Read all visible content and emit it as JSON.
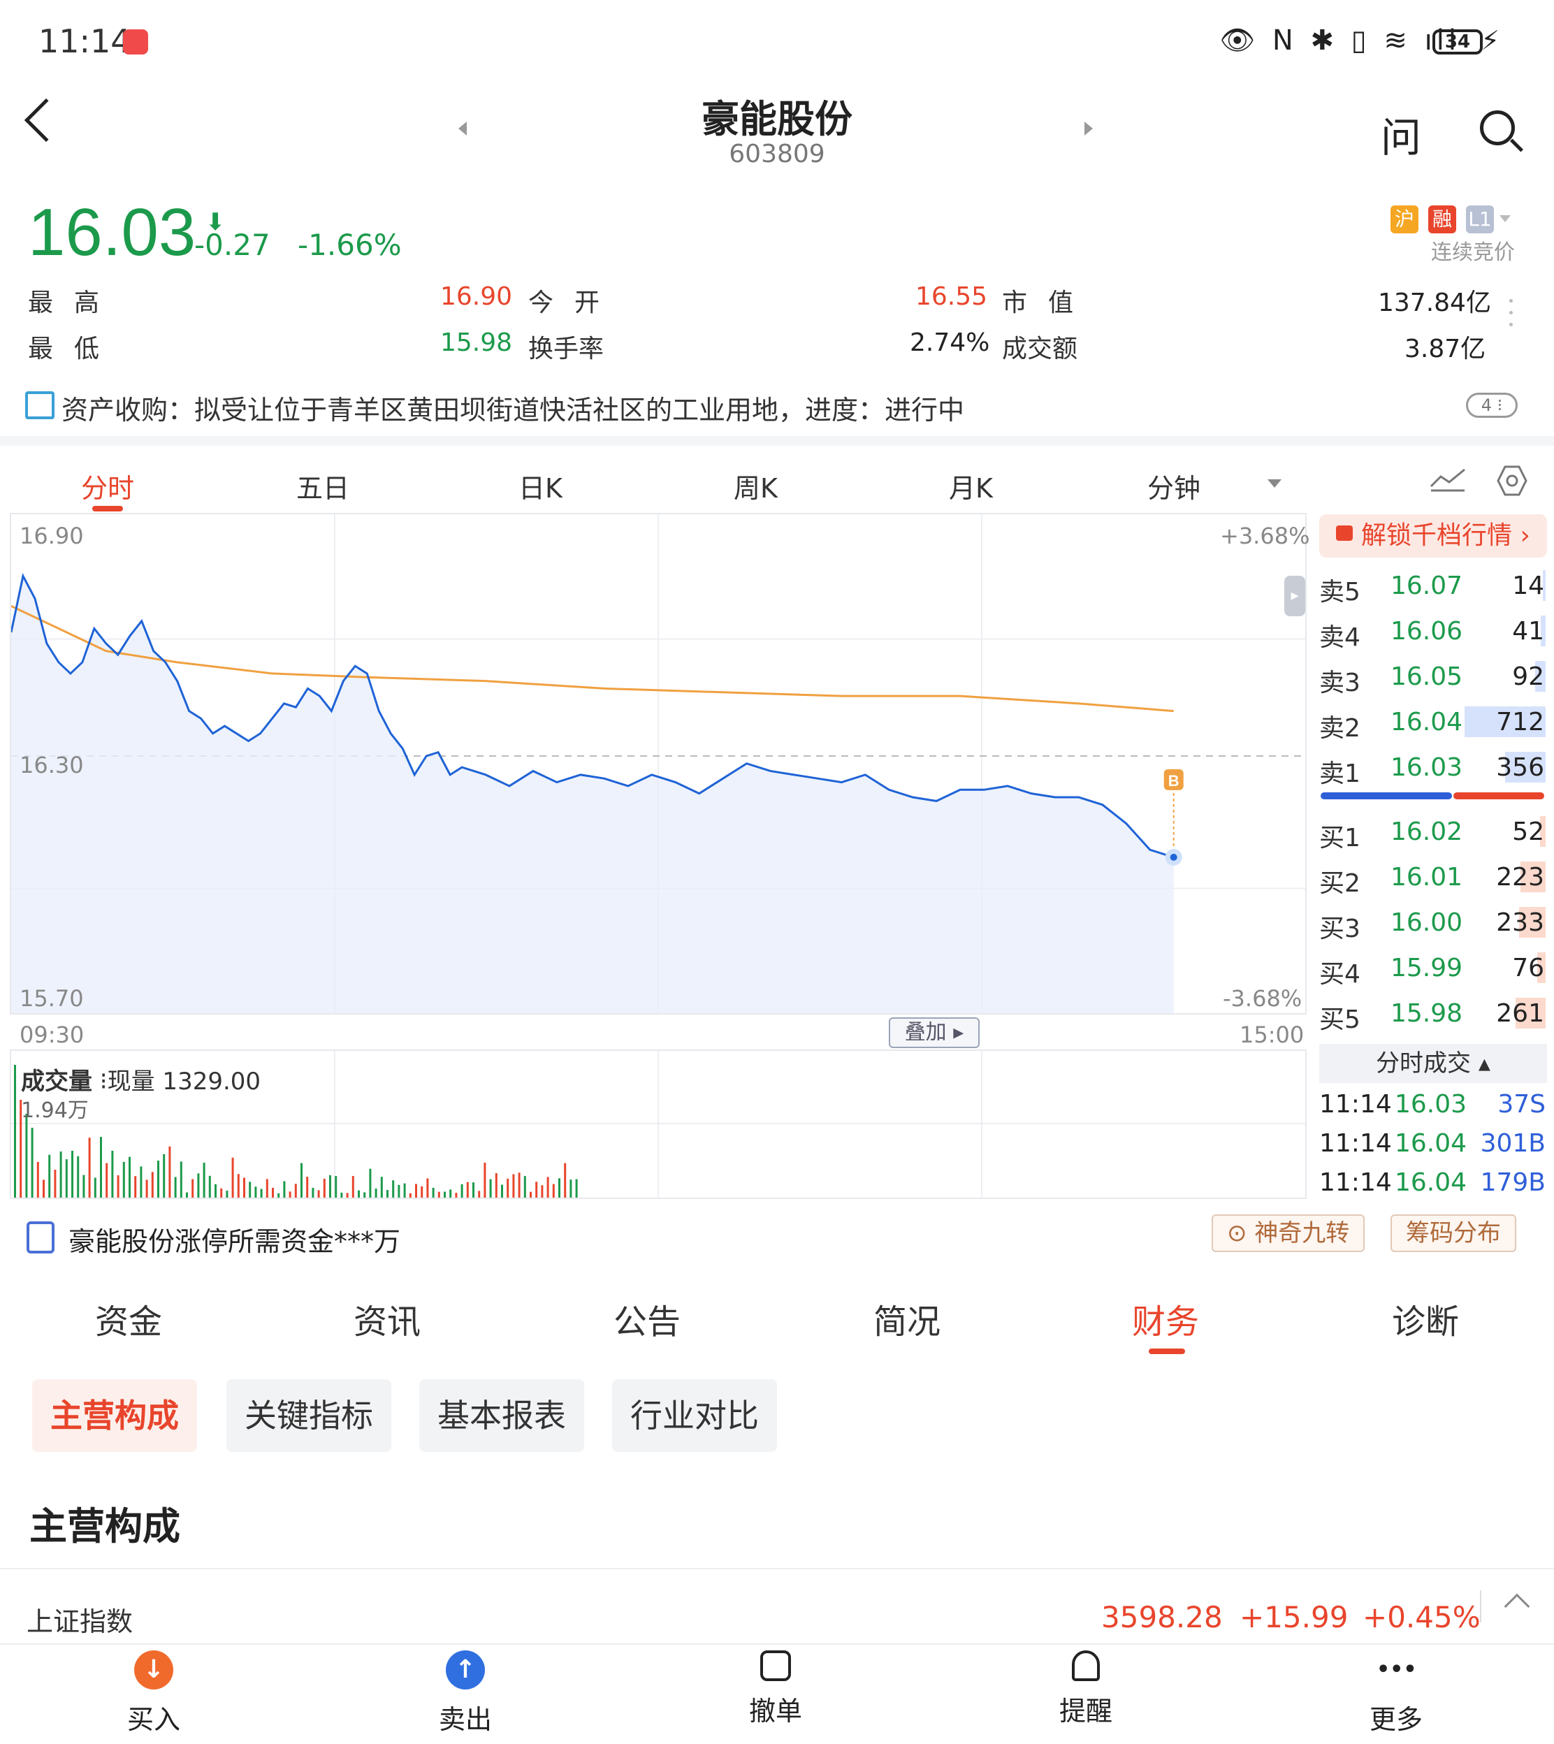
{
  "status": {
    "time": "11:14",
    "battery": "34"
  },
  "header": {
    "title": "豪能股份",
    "code": "603809"
  },
  "quote": {
    "price": "16.03",
    "change": "-0.27",
    "change_pct": "-1.66%",
    "tags": [
      "沪",
      "融",
      "L1"
    ],
    "auction": "连续竞价",
    "stats": [
      {
        "label": "最高",
        "value": "16.90"
      },
      {
        "label": "今开",
        "value": "16.55"
      },
      {
        "label": "市值",
        "value": "137.84亿"
      },
      {
        "label": "最低",
        "value": "15.98"
      },
      {
        "label": "换手率",
        "value": "2.74%"
      },
      {
        "label": "成交额",
        "value": "3.87亿"
      }
    ]
  },
  "notice": {
    "text": "资产收购：拟受让位于青羊区黄田坝街道快活社区的工业用地，进度：进行中",
    "badge": "4"
  },
  "chart_tabs": [
    "分时",
    "五日",
    "日K",
    "周K",
    "月K",
    "分钟"
  ],
  "chart": {
    "y_top": "16.90",
    "y_mid": "16.30",
    "y_bot": "15.70",
    "pct_top": "+3.68%",
    "pct_bot": "-3.68%",
    "t_start": "09:30",
    "t_end": "15:00",
    "overlay": "叠加",
    "marker": "B",
    "colors": {
      "price": "#1f63d6",
      "avg": "#f0a040",
      "fill": "#e8effb"
    }
  },
  "chart_data": {
    "type": "line",
    "ylim": [
      15.7,
      16.9
    ],
    "prev_close": 16.3,
    "x_total_minutes": 240,
    "x_start_label": "09:30",
    "x_end_label": "15:00",
    "series": [
      {
        "points": [
          [
            0,
            16.63
          ],
          [
            1,
            16.78
          ],
          [
            2,
            16.72
          ],
          [
            3,
            16.6
          ],
          [
            4,
            16.55
          ],
          [
            5,
            16.52
          ],
          [
            6,
            16.55
          ],
          [
            7,
            16.64
          ],
          [
            8,
            16.6
          ],
          [
            9,
            16.57
          ],
          [
            10,
            16.62
          ],
          [
            11,
            16.66
          ],
          [
            12,
            16.58
          ],
          [
            13,
            16.55
          ],
          [
            14,
            16.5
          ],
          [
            15,
            16.42
          ],
          [
            16,
            16.4
          ],
          [
            17,
            16.36
          ],
          [
            18,
            16.38
          ],
          [
            19,
            16.36
          ],
          [
            20,
            16.34
          ],
          [
            21,
            16.36
          ],
          [
            22,
            16.4
          ],
          [
            23,
            16.44
          ],
          [
            24,
            16.43
          ],
          [
            25,
            16.48
          ],
          [
            26,
            16.46
          ],
          [
            27,
            16.42
          ],
          [
            28,
            16.5
          ],
          [
            29,
            16.54
          ],
          [
            30,
            16.52
          ],
          [
            31,
            16.42
          ],
          [
            32,
            16.36
          ],
          [
            33,
            16.32
          ],
          [
            34,
            16.25
          ],
          [
            35,
            16.3
          ],
          [
            36,
            16.31
          ],
          [
            37,
            16.25
          ],
          [
            38,
            16.27
          ],
          [
            40,
            16.25
          ],
          [
            42,
            16.22
          ],
          [
            44,
            16.26
          ],
          [
            46,
            16.23
          ],
          [
            48,
            16.25
          ],
          [
            50,
            16.24
          ],
          [
            52,
            16.22
          ],
          [
            54,
            16.25
          ],
          [
            56,
            16.23
          ],
          [
            58,
            16.2
          ],
          [
            60,
            16.24
          ],
          [
            62,
            16.28
          ],
          [
            64,
            16.26
          ],
          [
            66,
            16.25
          ],
          [
            68,
            16.24
          ],
          [
            70,
            16.23
          ],
          [
            72,
            16.25
          ],
          [
            74,
            16.21
          ],
          [
            76,
            16.19
          ],
          [
            78,
            16.18
          ],
          [
            80,
            16.21
          ],
          [
            82,
            16.21
          ],
          [
            84,
            16.22
          ],
          [
            86,
            16.2
          ],
          [
            88,
            16.19
          ],
          [
            90,
            16.19
          ],
          [
            92,
            16.17
          ],
          [
            94,
            16.12
          ],
          [
            96,
            16.05
          ],
          [
            98,
            16.03
          ]
        ]
      },
      {
        "points": [
          [
            0,
            16.7
          ],
          [
            4,
            16.64
          ],
          [
            8,
            16.58
          ],
          [
            14,
            16.55
          ],
          [
            22,
            16.52
          ],
          [
            30,
            16.51
          ],
          [
            40,
            16.5
          ],
          [
            50,
            16.48
          ],
          [
            60,
            16.47
          ],
          [
            70,
            16.46
          ],
          [
            80,
            16.46
          ],
          [
            90,
            16.44
          ],
          [
            98,
            16.42
          ]
        ]
      }
    ]
  },
  "volume": {
    "title": "成交量",
    "current": "现量 1329.00",
    "max": "1.94万"
  },
  "order_book": {
    "unlock": "解锁千档行情",
    "asks": [
      {
        "label": "卖5",
        "price": "16.07",
        "vol": "14"
      },
      {
        "label": "卖4",
        "price": "16.06",
        "vol": "41"
      },
      {
        "label": "卖3",
        "price": "16.05",
        "vol": "92"
      },
      {
        "label": "卖2",
        "price": "16.04",
        "vol": "712"
      },
      {
        "label": "卖1",
        "price": "16.03",
        "vol": "356"
      }
    ],
    "bids": [
      {
        "label": "买1",
        "price": "16.02",
        "vol": "52"
      },
      {
        "label": "买2",
        "price": "16.01",
        "vol": "223"
      },
      {
        "label": "买3",
        "price": "16.00",
        "vol": "233"
      },
      {
        "label": "买4",
        "price": "15.99",
        "vol": "76"
      },
      {
        "label": "买5",
        "price": "15.98",
        "vol": "261"
      }
    ],
    "ticks_title": "分时成交",
    "ticks": [
      {
        "time": "11:14",
        "price": "16.03",
        "vol": "37S"
      },
      {
        "time": "11:14",
        "price": "16.04",
        "vol": "301B"
      },
      {
        "time": "11:14",
        "price": "16.04",
        "vol": "179B"
      }
    ]
  },
  "strip": {
    "text": "豪能股份涨停所需资金***万",
    "pill1": "神奇九转",
    "pill2": "筹码分布"
  },
  "section_tabs": [
    "资金",
    "资讯",
    "公告",
    "简况",
    "财务",
    "诊断"
  ],
  "sub_tabs": [
    "主营构成",
    "关键指标",
    "基本报表",
    "行业对比"
  ],
  "section_title": "主营构成",
  "index": {
    "name": "上证指数",
    "value": "3598.28",
    "change": "+15.99",
    "pct": "+0.45%"
  },
  "bottom_nav": [
    {
      "label": "买入",
      "icon": "↓"
    },
    {
      "label": "卖出",
      "icon": "↑"
    },
    {
      "label": "撤单",
      "icon": ""
    },
    {
      "label": "提醒",
      "icon": ""
    },
    {
      "label": "更多",
      "icon": "•••"
    }
  ]
}
